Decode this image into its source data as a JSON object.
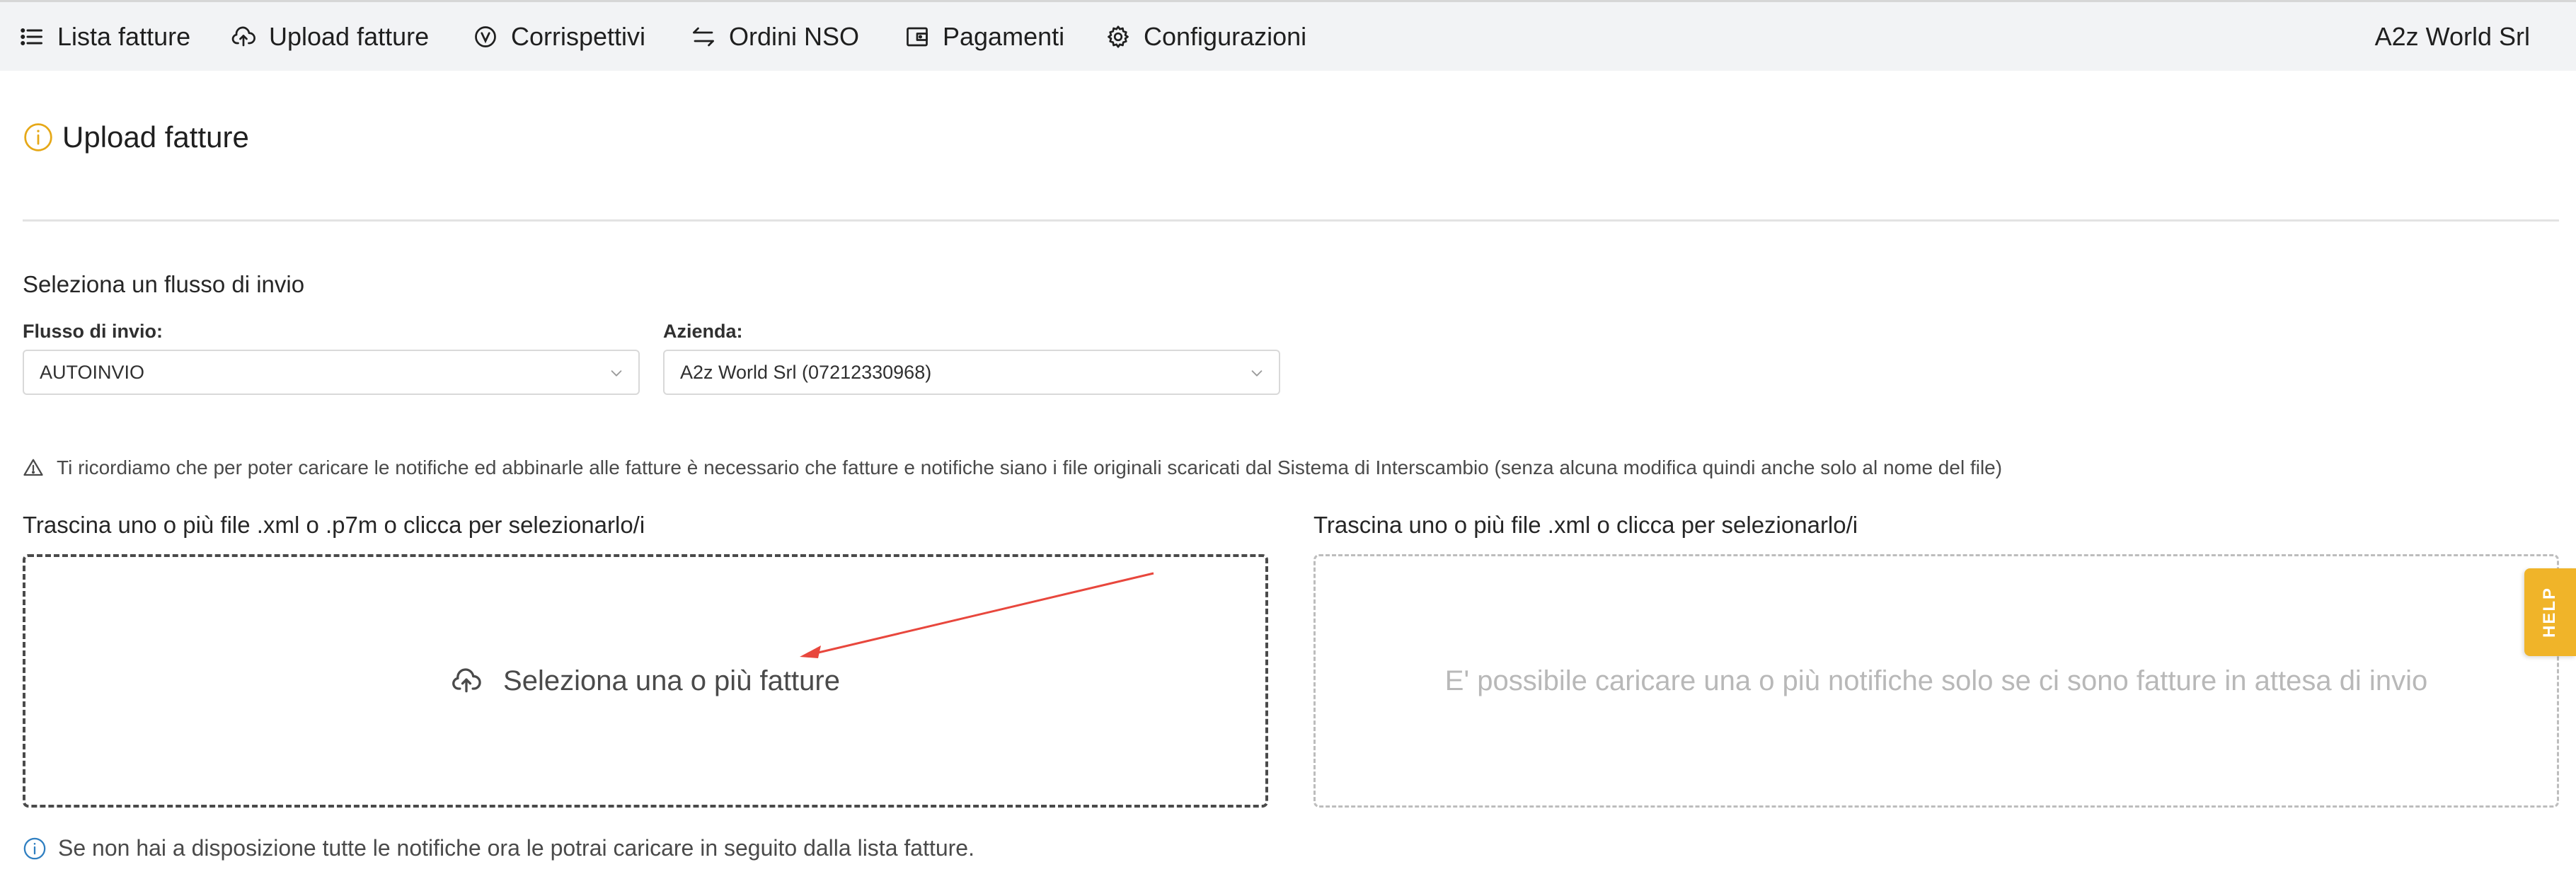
{
  "nav": {
    "items": [
      {
        "label": "Lista fatture",
        "icon": "list-icon"
      },
      {
        "label": "Upload fatture",
        "icon": "cloud-upload-icon"
      },
      {
        "label": "Corrispettivi",
        "icon": "euro-circle-icon"
      },
      {
        "label": "Ordini NSO",
        "icon": "swap-icon"
      },
      {
        "label": "Pagamenti",
        "icon": "wallet-icon"
      },
      {
        "label": "Configurazioni",
        "icon": "gear-icon"
      }
    ],
    "company": "A2z World Srl"
  },
  "page": {
    "title": "Upload fatture",
    "title_icon": "info-circle-icon",
    "accent_color": "#e6a817"
  },
  "flow": {
    "section_title": "Seleziona un flusso di invio",
    "flusso_label": "Flusso di invio",
    "flusso_value": "AUTOINVIO",
    "azienda_label": "Azienda",
    "azienda_value": "A2z World Srl (07212330968)"
  },
  "warning": {
    "icon": "warning-triangle-icon",
    "text": "Ti ricordiamo che per poter caricare le notifiche ed abbinarle alle fatture è necessario che fatture e notifiche siano i file originali scaricati dal Sistema di Interscambio (senza alcuna modifica quindi anche solo al nome del file)"
  },
  "upload": {
    "invoices_label": "Trascina uno o più file .xml o .p7m o clicca per selezionarlo/i",
    "invoices_button": "Seleziona una o più fatture",
    "notifications_label": "Trascina uno o più file .xml o clicca per selezionarlo/i",
    "notifications_disabled_text": "E' possibile caricare una o più notifiche solo se ci sono fatture in attesa di invio"
  },
  "help": {
    "label": "HELP",
    "color": "#f0b429"
  },
  "info_note": {
    "icon": "info-circle-icon",
    "text": "Se non hai a disposizione tutte le notifiche ora le potrai caricare in seguito dalla lista fatture.",
    "color": "#2f7fc1"
  }
}
